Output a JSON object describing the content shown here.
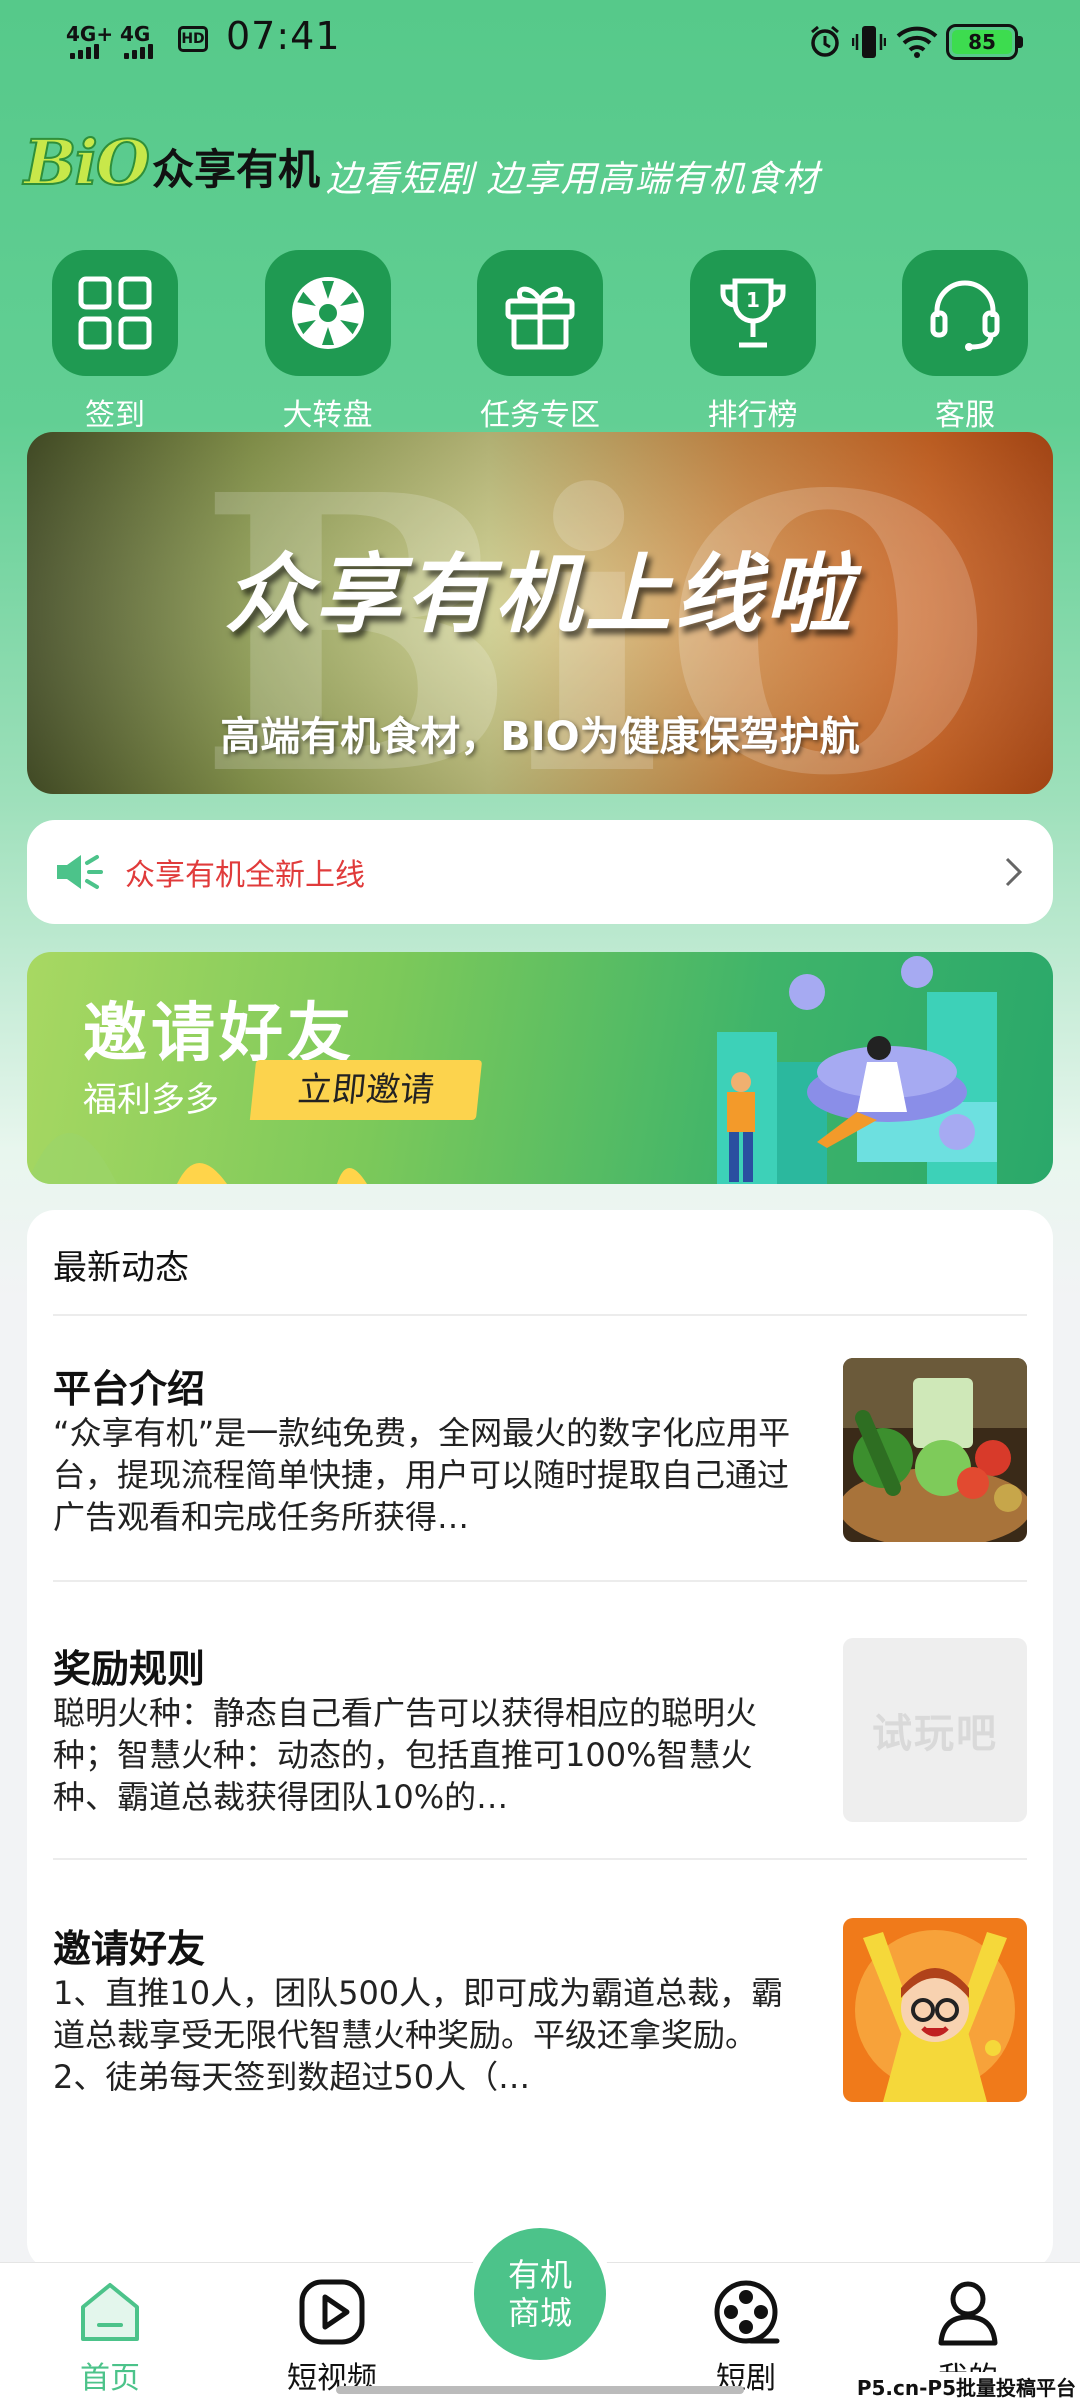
{
  "status_bar": {
    "sim1": "4G+",
    "sim2": "4G",
    "hd": "HD",
    "time": "07:41",
    "battery": "85"
  },
  "header": {
    "logo_mark": "BiO",
    "logo_name": "众享有机",
    "slogan": "边看短剧  边享用高端有机食材"
  },
  "quick_menu": [
    {
      "label": "签到",
      "icon": "grid-icon"
    },
    {
      "label": "大转盘",
      "icon": "wheel-icon"
    },
    {
      "label": "任务专区",
      "icon": "gift-icon"
    },
    {
      "label": "排行榜",
      "icon": "trophy-icon"
    },
    {
      "label": "客服",
      "icon": "headset-icon"
    }
  ],
  "banner": {
    "watermark": "BiO",
    "title": "众享有机上线啦",
    "subtitle": "高端有机食材，BIO为健康保驾护航"
  },
  "notice": {
    "text": "众享有机全新上线"
  },
  "invite": {
    "title": "邀请好友",
    "subtitle": "福利多多",
    "button": "立即邀请"
  },
  "news": {
    "heading": "最新动态",
    "items": [
      {
        "title": "平台介绍",
        "body": "“众享有机”是一款纯免费，全网最火的数字化应用平台，提现流程简单快捷，用户可以随时提取自己通过广告观看和完成任务所获得…",
        "thumb": "vegetable-basket-image"
      },
      {
        "title": "奖励规则",
        "body": "聪明火种：静态自己看广告可以获得相应的聪明火种；智慧火种：动态的，包括直推可100%智慧火种、霸道总裁获得团队10%的…",
        "thumb_text": "试玩吧"
      },
      {
        "title": "邀请好友",
        "body": "1、直推10人，团队500人，即可成为霸道总裁，霸道总裁享受无限代智慧火种奖励。平级还拿奖励。2、徒弟每天签到数超过50人（…",
        "thumb": "cheering-cartoon-image"
      }
    ]
  },
  "tabbar": {
    "home": "首页",
    "short_video": "短视频",
    "center_line1": "有机",
    "center_line2": "商城",
    "drama": "短剧",
    "mine": "我的"
  },
  "watermark": "P5.cn-P5批量投稿平台",
  "colors": {
    "primary": "#56c98a",
    "icon_bg": "#1f9a52",
    "notice_red": "#e03b3b",
    "active_tab": "#4cc38a",
    "invite_button": "#fcd34d"
  }
}
